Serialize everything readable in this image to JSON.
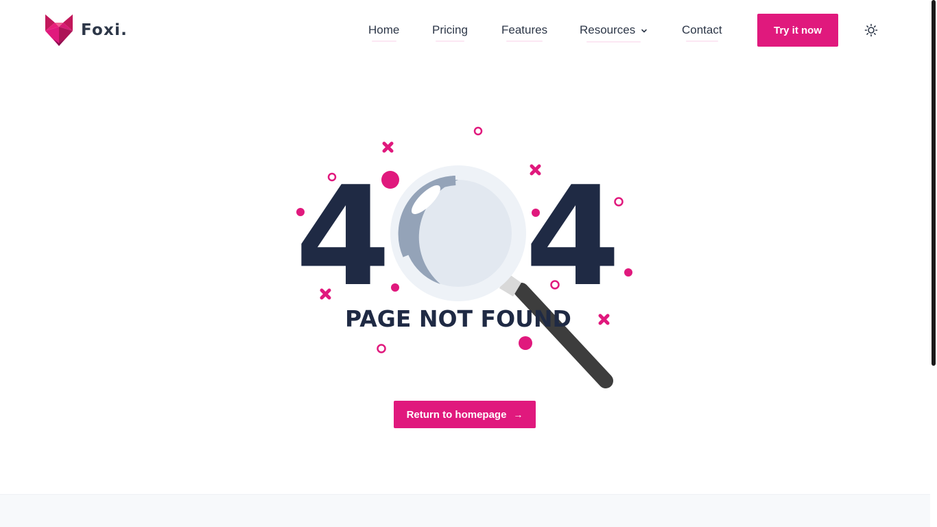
{
  "brand": {
    "name": "Foxi",
    "dot": ".",
    "accent": "#e0197d",
    "dark": "#1f2a44"
  },
  "nav": {
    "items": [
      {
        "label": "Home"
      },
      {
        "label": "Pricing"
      },
      {
        "label": "Features"
      },
      {
        "label": "Resources",
        "has_dropdown": true
      },
      {
        "label": "Contact"
      }
    ],
    "cta_label": "Try it now",
    "theme_icon": "sun-icon"
  },
  "error": {
    "left_digit": "4",
    "right_digit": "4",
    "message": "PAGE NOT FOUND"
  },
  "actions": {
    "return_label": "Return to homepage",
    "return_arrow": "→"
  }
}
